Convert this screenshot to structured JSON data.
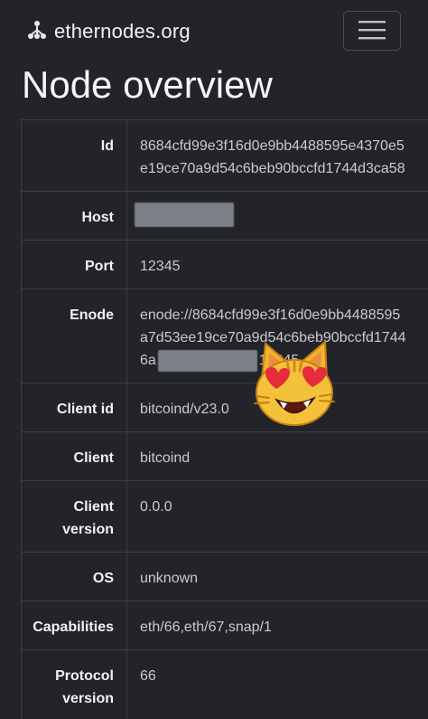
{
  "navbar": {
    "brand": "ethernodes.org",
    "logo_icon": "node-tree-icon",
    "menu_icon": "hamburger-icon"
  },
  "page": {
    "title": "Node overview"
  },
  "rows": [
    {
      "label": "Id",
      "lines": [
        "8684cfd99e3f16d0e9bb4488595e4370e5",
        "e19ce70a9d54c6beb90bccfd1744d3ca58"
      ]
    },
    {
      "label": "Host",
      "lines": [
        ""
      ]
    },
    {
      "label": "Port",
      "lines": [
        "12345"
      ]
    },
    {
      "label": "Enode",
      "lines": [
        "enode://8684cfd99e3f16d0e9bb4488595",
        "a7d53ee19ce70a9d54c6beb90bccfd1744",
        "6a",
        "12345"
      ]
    },
    {
      "label": "Client id",
      "lines": [
        "bitcoind/v23.0"
      ]
    },
    {
      "label": "Client",
      "lines": [
        "bitcoind"
      ]
    },
    {
      "label": "Client version",
      "label_lines": [
        "Client",
        "version"
      ],
      "lines": [
        "0.0.0"
      ]
    },
    {
      "label": "OS",
      "lines": [
        "unknown"
      ]
    },
    {
      "label": "Capabilities",
      "lines": [
        "eth/66,eth/67,snap/1"
      ]
    },
    {
      "label": "Protocol version",
      "label_lines": [
        "Protocol",
        "version"
      ],
      "lines": [
        "66"
      ]
    }
  ],
  "overlay": {
    "sticker": "heart-eyes-cat-icon"
  },
  "colors": {
    "background": "#222429",
    "border": "#3b3e44",
    "text": "#e8e8ea"
  }
}
